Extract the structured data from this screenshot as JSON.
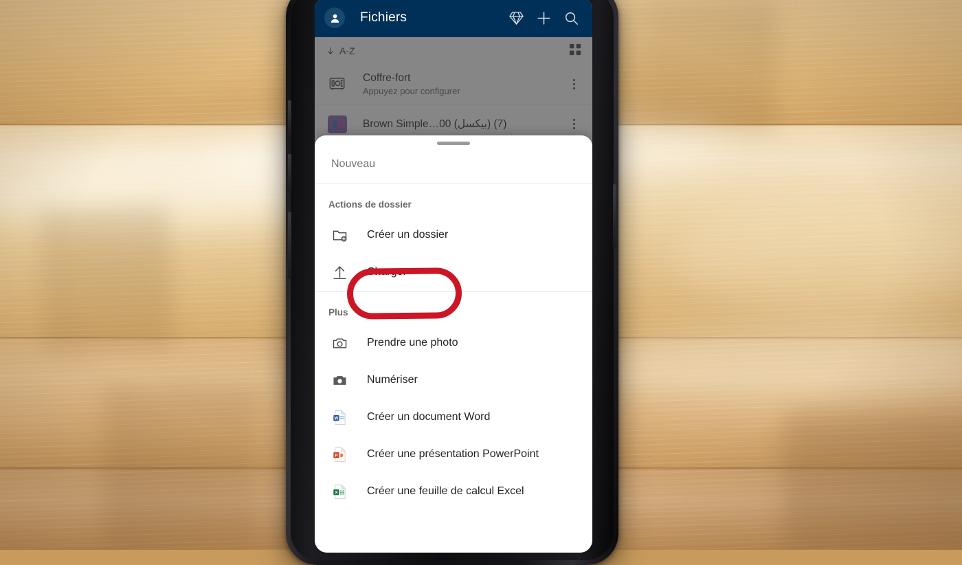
{
  "app": {
    "title": "Fichiers",
    "icons": {
      "avatar": "account-avatar-icon",
      "premium": "diamond-premium-icon",
      "add": "plus-icon",
      "search": "search-icon"
    }
  },
  "list": {
    "sort": {
      "label": "A-Z",
      "direction_icon": "arrow-down-icon"
    },
    "view_toggle_icon": "grid-view-icon",
    "items": [
      {
        "icon": "vault-safe-icon",
        "title": "Coffre-fort",
        "subtitle": "Appuyez pour configurer",
        "menu_icon": "kebab-menu-icon"
      },
      {
        "icon": "image-thumbnail-icon",
        "title": "Brown Simple…00 (بيكسل) (7)",
        "subtitle": "",
        "menu_icon": "kebab-menu-icon"
      }
    ]
  },
  "sheet": {
    "handle": "drag-handle",
    "header": "Nouveau",
    "sections": [
      {
        "title": "Actions de dossier",
        "items": [
          {
            "icon": "folder-add-icon",
            "label": "Créer un dossier",
            "highlighted": false
          },
          {
            "icon": "upload-arrow-icon",
            "label": "Charger",
            "highlighted": true
          }
        ]
      },
      {
        "title": "Plus",
        "items": [
          {
            "icon": "camera-outline-icon",
            "label": "Prendre une photo",
            "highlighted": false
          },
          {
            "icon": "camera-filled-icon",
            "label": "Numériser",
            "highlighted": false
          },
          {
            "icon": "word-document-icon",
            "label": "Créer un document Word",
            "highlighted": false
          },
          {
            "icon": "powerpoint-document-icon",
            "label": "Créer une présentation PowerPoint",
            "highlighted": false
          },
          {
            "icon": "excel-document-icon",
            "label": "Créer une feuille de calcul Excel",
            "highlighted": false
          }
        ]
      }
    ]
  },
  "annotation": {
    "shape": "ellipse",
    "target": "Charger",
    "color": "#cc1626"
  },
  "colors": {
    "appbar": "#003057",
    "scrim": "rgba(60,60,60,0.62)",
    "sheet_background": "#ffffff",
    "annotation_red": "#cc1626",
    "word_blue": "#2b579a",
    "powerpoint_orange": "#d24726",
    "excel_green": "#217346"
  }
}
